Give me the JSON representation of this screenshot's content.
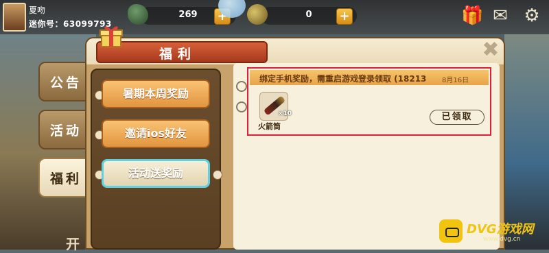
{
  "header": {
    "player_name": "夏吻",
    "player_id": "迷你号：63099793",
    "gems": "269",
    "coins": "0",
    "plus": "+"
  },
  "side_tabs": [
    {
      "label": "公告",
      "active": false
    },
    {
      "label": "活动",
      "active": false
    },
    {
      "label": "福利",
      "active": true
    }
  ],
  "panel": {
    "title": "福利",
    "close": "✖"
  },
  "submenu": [
    {
      "label": "暑期本周奖励",
      "active": false
    },
    {
      "label": "邀请ios好友",
      "active": false
    },
    {
      "label": "活动送奖励",
      "active": true
    }
  ],
  "reward_card": {
    "title": "绑定手机奖励，需重启游戏登录领取 (18213",
    "date": "8月16日",
    "item_name": "火箭筒",
    "item_count": "×10",
    "status_button": "已领取"
  },
  "watermark": {
    "brand": "DVG游戏网",
    "url": "www.dvg.cn"
  },
  "bottom_char": "开"
}
